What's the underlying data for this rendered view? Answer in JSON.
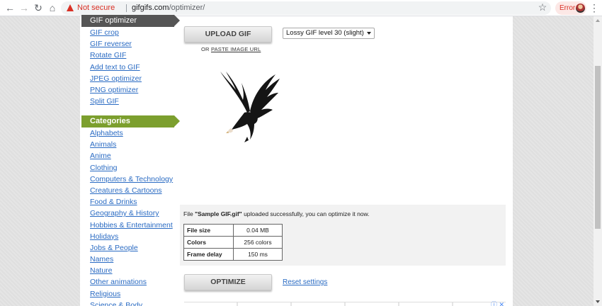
{
  "browser": {
    "security_label": "Not secure",
    "url_domain": "gifgifs.com",
    "url_path": "/optimizer/",
    "error_label": "Error",
    "icons": {
      "back": "arrow-left-icon",
      "forward": "arrow-right-icon",
      "reload": "reload-icon",
      "home": "home-icon",
      "warning": "warning-icon",
      "bookmark": "star-icon",
      "menu": "kebab-icon"
    }
  },
  "sidebar": {
    "tools_header": "GIF optimizer",
    "tools": [
      "GIF crop",
      "GIF reverser",
      "Rotate GIF",
      "Add text to GIF",
      "JPEG optimizer",
      "PNG optimizer",
      "Split GIF"
    ],
    "categories_header": "Categories",
    "categories": [
      "Alphabets",
      "Animals",
      "Anime",
      "Clothing",
      "Computers & Technology",
      "Creatures & Cartoons",
      "Food & Drinks",
      "Geography & History",
      "Hobbies & Entertainment",
      "Holidays",
      "Jobs & People",
      "Names",
      "Nature",
      "Other animations",
      "Religious",
      "Science & Body"
    ]
  },
  "main": {
    "upload_label": "UPLOAD GIF",
    "paste_prefix": "OR",
    "paste_link": "PASTE IMAGE URL",
    "level_select": "Lossy GIF level 30 (slight)",
    "status_prefix": "File ",
    "file_name": "\"Sample GIF.gif\"",
    "status_suffix": " uploaded successfully, you can optimize it now.",
    "stats": [
      {
        "label": "File size",
        "value": "0.04 MB"
      },
      {
        "label": "Colors",
        "value": "256 colors"
      },
      {
        "label": "Frame delay",
        "value": "150 ms"
      }
    ],
    "optimize_label": "OPTIMIZE",
    "reset_label": "Reset settings"
  },
  "colors": {
    "link": "#2a6bc3",
    "category_header": "#7c9f2e",
    "tool_header": "#555555",
    "warning": "#d93025"
  }
}
